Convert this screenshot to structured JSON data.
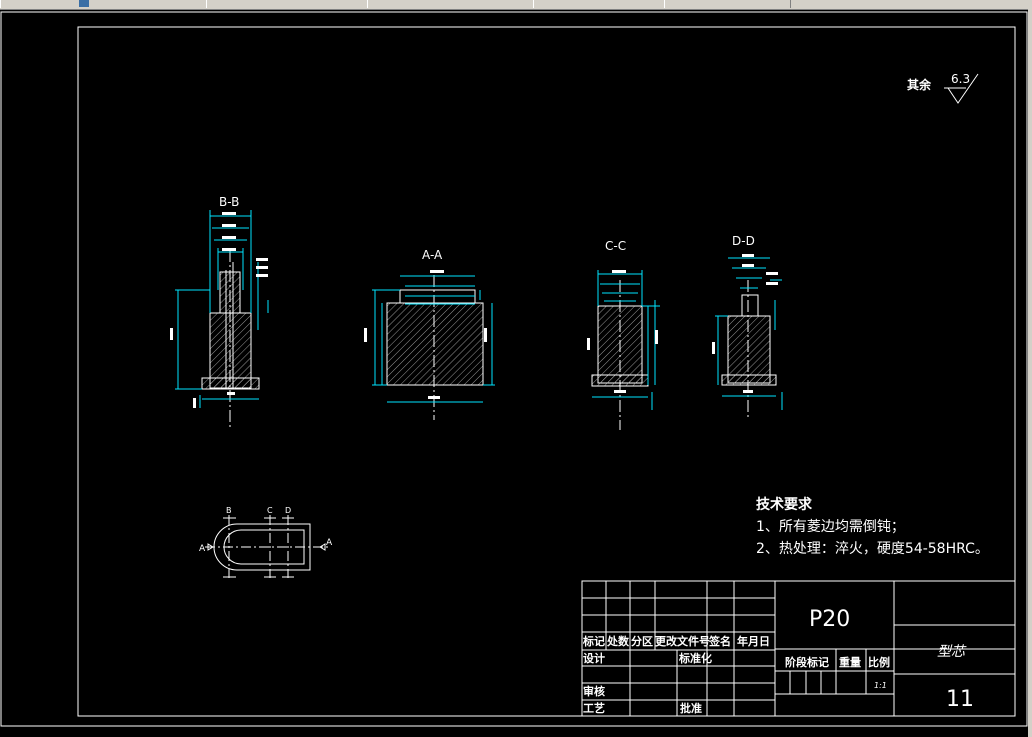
{
  "drawing": {
    "surface_note": "其余",
    "surface_roughness": "6.3",
    "sections": {
      "bb": "B-B",
      "aa": "A-A",
      "cc": "C-C",
      "dd": "D-D"
    },
    "plan_view_markers": {
      "a_left": "A",
      "a_right": "A",
      "b": "B",
      "c": "C",
      "d": "D"
    },
    "tech_requirements": {
      "title": "技术要求",
      "items": [
        "1、所有菱边均需倒钝；",
        "2、热处理：淬火，硬度54-58HRC。"
      ]
    },
    "title_block": {
      "material": "P20",
      "part_name": "型芯",
      "sheet_number": "11",
      "scale": "1:1",
      "headers": [
        "标记",
        "处数",
        "分区",
        "更改文件号",
        "签名",
        "年月日"
      ],
      "design": "设计",
      "standardization": "标准化",
      "review": "审核",
      "process": "工艺",
      "approve": "批准",
      "stage_mark": "阶段标记",
      "weight": "重量",
      "scale_label": "比例"
    }
  },
  "colors": {
    "line": "#ffffff",
    "dimension": "#00e5ff",
    "hatch": "#bfbfbf",
    "background": "#000000"
  }
}
